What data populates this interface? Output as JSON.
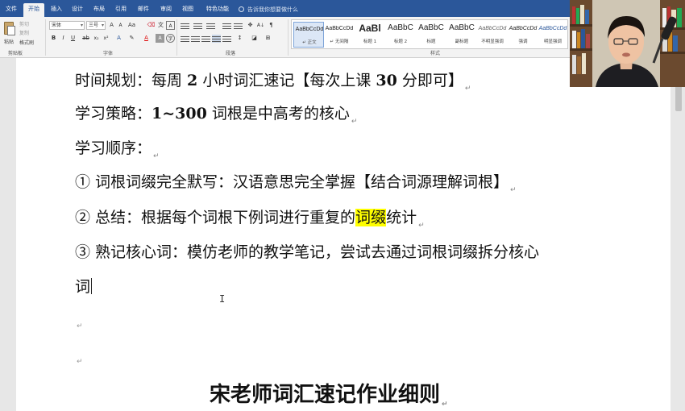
{
  "tabs": [
    {
      "label": "文件",
      "active": false
    },
    {
      "label": "开始",
      "active": true
    },
    {
      "label": "插入",
      "active": false
    },
    {
      "label": "设计",
      "active": false
    },
    {
      "label": "布局",
      "active": false
    },
    {
      "label": "引用",
      "active": false
    },
    {
      "label": "邮件",
      "active": false
    },
    {
      "label": "审阅",
      "active": false
    },
    {
      "label": "视图",
      "active": false
    },
    {
      "label": "特色功能",
      "active": false
    }
  ],
  "tell_me": "告诉我你想要做什么",
  "ribbon": {
    "clipboard": {
      "paste": "粘贴",
      "cut": "剪切",
      "copy": "复制",
      "format_painter": "格式刷",
      "group_label": "剪贴板"
    },
    "font": {
      "font_name": "宋体",
      "font_size": "三号",
      "group_label": "字体"
    },
    "paragraph": {
      "group_label": "段落"
    },
    "styles": {
      "group_label": "样式",
      "items": [
        {
          "sample": "AaBbCcDd",
          "name": "↵ 正文",
          "selected": true
        },
        {
          "sample": "AaBbCcDd",
          "name": "↵ 无间隔",
          "selected": false
        },
        {
          "sample": "AaBl",
          "name": "标题 1",
          "selected": false
        },
        {
          "sample": "AaBbC",
          "name": "标题 2",
          "selected": false
        },
        {
          "sample": "AaBbC",
          "name": "标题",
          "selected": false
        },
        {
          "sample": "AaBbC",
          "name": "副标题",
          "selected": false
        },
        {
          "sample": "AaBbCcDd",
          "name": "不明显强调",
          "selected": false
        },
        {
          "sample": "AaBbCcDd",
          "name": "强调",
          "selected": false
        },
        {
          "sample": "AaBbCcDd",
          "name": "明显强调",
          "selected": false
        }
      ]
    }
  },
  "document": {
    "line1": {
      "a": "时间规划：每周 ",
      "b": "2",
      "c": " 小时词汇速记【每次上课 ",
      "d": "30",
      "e": " 分即可】"
    },
    "line2": {
      "a": "学习策略：",
      "b": "1~300",
      "c": " 词根是中高考的核心"
    },
    "line3": "学习顺序：",
    "line4": "①  词根词缀完全默写：汉语意思完全掌握【结合词源理解词根】",
    "line5": {
      "a": "②  总结：根据每个词根下例词进行重复的",
      "hl": "词缀",
      "c": "统计"
    },
    "line6": "③  熟记核心词：模仿老师的教学笔记，尝试去通过词根词缀拆分核心",
    "line7": "词",
    "heading": "宋老师词汇速记作业细则"
  },
  "colors": {
    "title_bar": "#2b579a",
    "ribbon_bg": "#f3f3f3",
    "highlight": "#ffff00"
  }
}
